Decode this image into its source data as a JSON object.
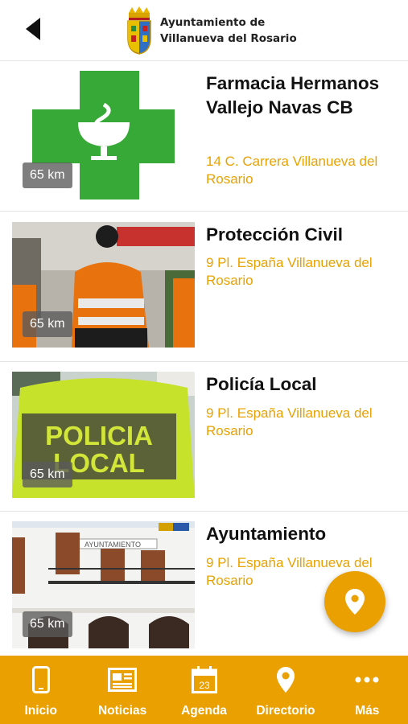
{
  "header": {
    "title_line1": "Ayuntamiento de",
    "title_line2": "Villanueva del Rosario",
    "back_icon": "arrow-left-icon",
    "logo_icon": "coat-of-arms-icon"
  },
  "colors": {
    "accent": "#e9a000",
    "pharmacy_green": "#36a936",
    "text_dark": "#111111"
  },
  "items": [
    {
      "title": "Farmacia Hermanos Vallejo Navas CB",
      "address": "14 C. Carrera Villanueva del Rosario",
      "distance": "65 km",
      "image": "pharmacy-cross"
    },
    {
      "title": "Protección Civil",
      "address": "9 Pl. España Villanueva del Rosario",
      "distance": "65 km",
      "image": "civil-protection-volunteers"
    },
    {
      "title": "Policía Local",
      "address": "9 Pl. España Villanueva del Rosario",
      "distance": "65 km",
      "image": "local-police-vest"
    },
    {
      "title": "Ayuntamiento",
      "address": "9 Pl. España Villanueva del Rosario",
      "distance": "65 km",
      "image": "town-hall-building"
    }
  ],
  "fab": {
    "icon": "map-pin-icon"
  },
  "building_sign": "AYUNTAMIENTO",
  "vest_text": {
    "line1": "POLICIA",
    "line2": "LOCAL"
  },
  "bottom_nav": [
    {
      "label": "Inicio",
      "icon": "phone-icon"
    },
    {
      "label": "Noticias",
      "icon": "newspaper-icon"
    },
    {
      "label": "Agenda",
      "icon": "calendar-icon",
      "day": "23"
    },
    {
      "label": "Directorio",
      "icon": "map-pin-icon"
    },
    {
      "label": "Más",
      "icon": "more-dots-icon"
    }
  ]
}
